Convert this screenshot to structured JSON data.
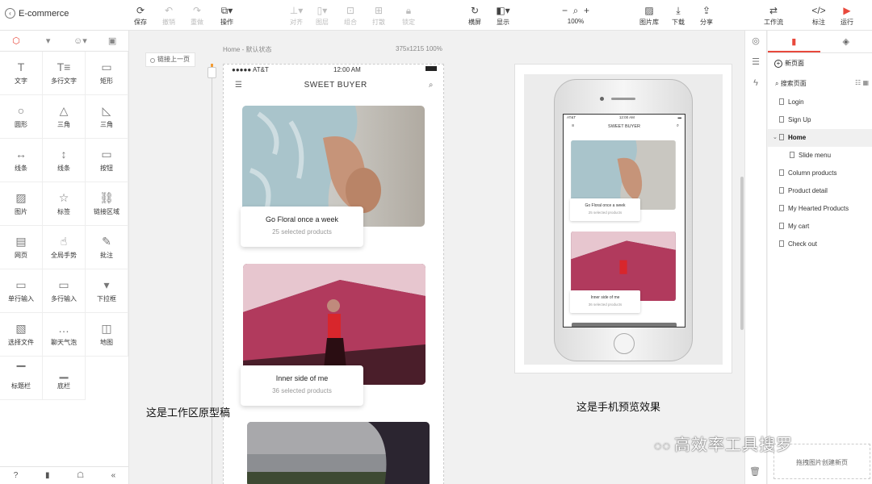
{
  "app": {
    "back_icon": "chevron-left-icon",
    "project_name": "E-commerce"
  },
  "toolbar": {
    "save": "保存",
    "undo": "撤销",
    "redo": "重做",
    "operate": "操作",
    "align": "对齐",
    "layer": "图层",
    "group": "组合",
    "ungroup": "打散",
    "lock": "锁定",
    "landscape": "横屏",
    "display": "显示",
    "zoom": "100%",
    "image_lib": "图片库",
    "download": "下载",
    "share": "分享",
    "workflow": "工作流",
    "annotate": "标注",
    "run": "运行"
  },
  "tools": [
    {
      "icon": "text-icon",
      "glyph": "T",
      "label": "文字"
    },
    {
      "icon": "multiline-text-icon",
      "glyph": "T≡",
      "label": "多行文字"
    },
    {
      "icon": "rectangle-icon",
      "glyph": "▭",
      "label": "矩形"
    },
    {
      "icon": "circle-icon",
      "glyph": "○",
      "label": "圆形"
    },
    {
      "icon": "triangle-icon",
      "glyph": "△",
      "label": "三角"
    },
    {
      "icon": "right-triangle-icon",
      "glyph": "◺",
      "label": "三角"
    },
    {
      "icon": "horizontal-line-icon",
      "glyph": "↔",
      "label": "线条"
    },
    {
      "icon": "vertical-line-icon",
      "glyph": "↕",
      "label": "线条"
    },
    {
      "icon": "button-icon",
      "glyph": "▭",
      "label": "按钮"
    },
    {
      "icon": "image-icon",
      "glyph": "▨",
      "label": "图片"
    },
    {
      "icon": "star-icon",
      "glyph": "☆",
      "label": "标签"
    },
    {
      "icon": "link-icon",
      "glyph": "⛓",
      "label": "链接区域"
    },
    {
      "icon": "webpage-icon",
      "glyph": "▤",
      "label": "网页"
    },
    {
      "icon": "gesture-icon",
      "glyph": "☝",
      "label": "全局手势"
    },
    {
      "icon": "comment-icon",
      "glyph": "✎",
      "label": "批注"
    },
    {
      "icon": "single-input-icon",
      "glyph": "▭",
      "label": "单行输入"
    },
    {
      "icon": "multi-input-icon",
      "glyph": "▭",
      "label": "多行输入"
    },
    {
      "icon": "dropdown-icon",
      "glyph": "▾",
      "label": "下拉框"
    },
    {
      "icon": "file-icon",
      "glyph": "▧",
      "label": "选择文件"
    },
    {
      "icon": "chat-bubble-icon",
      "glyph": "…",
      "label": "聊天气泡"
    },
    {
      "icon": "map-icon",
      "glyph": "◫",
      "label": "地图"
    },
    {
      "icon": "titlebar-icon",
      "glyph": "▔",
      "label": "标题栏"
    },
    {
      "icon": "bottombar-icon",
      "glyph": "▁",
      "label": "底栏"
    }
  ],
  "canvas": {
    "page_label": "Home - 默认状态",
    "size_label": "375x1215 100%",
    "link_prev": "链接上一页",
    "note_workspace": "这是工作区原型稿",
    "note_preview": "这是手机预览效果"
  },
  "mobile": {
    "carrier": "AT&T",
    "time": "12:00 AM",
    "title": "SWEET BUYER",
    "cards": [
      {
        "title": "Go Floral once a week",
        "subtitle": "25 selected products"
      },
      {
        "title": "Inner side of me",
        "subtitle": "36 selected products"
      }
    ]
  },
  "pages_panel": {
    "new_page": "新页面",
    "search": "搜索页面",
    "pages": [
      "Login",
      "Sign Up",
      "Home",
      "Slide menu",
      "Column products",
      "Product detail",
      "My Hearted Products",
      "My cart",
      "Check out"
    ],
    "drop_hint": "拖拽图片创建新页"
  },
  "watermark": "高效率工具搜罗",
  "colors": {
    "accent": "#e8493c",
    "handle": "#f39c35"
  }
}
